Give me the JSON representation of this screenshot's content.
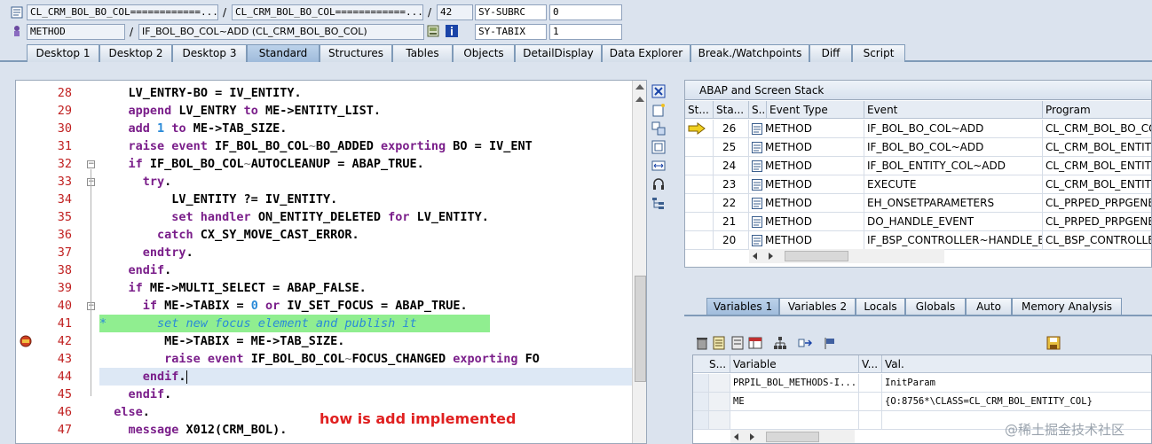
{
  "header": {
    "row1": {
      "f1": "CL_CRM_BOL_BO_COL============...",
      "sep1": "/",
      "f2": "CL_CRM_BOL_BO_COL============...",
      "sep2": "/",
      "f3": "42",
      "f4": "SY-SUBRC",
      "f5": "0"
    },
    "row2": {
      "f1": "METHOD",
      "sep1": "/",
      "f2": "IF_BOL_BO_COL~ADD (CL_CRM_BOL_BO_COL)",
      "f4": "SY-TABIX",
      "f5": "1"
    }
  },
  "tabs": [
    "Desktop 1",
    "Desktop 2",
    "Desktop 3",
    "Standard",
    "Structures",
    "Tables",
    "Objects",
    "DetailDisplay",
    "Data Explorer",
    "Break./Watchpoints",
    "Diff",
    "Script"
  ],
  "active_tab": "Standard",
  "editor": {
    "lines": [
      {
        "n": "28",
        "t": [
          [
            "    ",
            ""
          ],
          [
            "LV_ENTRY",
            ""
          ],
          [
            "-",
            ""
          ],
          [
            "BO = IV_ENTITY.",
            ""
          ]
        ]
      },
      {
        "n": "29",
        "t": [
          [
            "    ",
            ""
          ],
          [
            "append",
            "kw"
          ],
          [
            " LV_ENTRY ",
            ""
          ],
          [
            "to",
            "kw"
          ],
          [
            " ME->ENTITY_LIST.",
            ""
          ]
        ]
      },
      {
        "n": "30",
        "t": [
          [
            "    ",
            ""
          ],
          [
            "add",
            "kw"
          ],
          [
            " ",
            ""
          ],
          [
            "1",
            "num"
          ],
          [
            " ",
            ""
          ],
          [
            "to",
            "kw"
          ],
          [
            " ME->TAB_SIZE.",
            ""
          ]
        ]
      },
      {
        "n": "31",
        "t": [
          [
            "    ",
            ""
          ],
          [
            "raise event",
            "kw"
          ],
          [
            " IF_BOL_BO_COL",
            ""
          ],
          [
            "~",
            "opr"
          ],
          [
            "BO_ADDED ",
            ""
          ],
          [
            "exporting",
            "kw"
          ],
          [
            " BO = IV_ENT",
            ""
          ]
        ]
      },
      {
        "n": "32",
        "t": [
          [
            "    ",
            ""
          ],
          [
            "if",
            "kw"
          ],
          [
            " IF_BOL_BO_COL",
            ""
          ],
          [
            "~",
            "opr"
          ],
          [
            "AUTOCLEANUP = ABAP_TRUE.",
            ""
          ]
        ]
      },
      {
        "n": "33",
        "t": [
          [
            "      ",
            ""
          ],
          [
            "try",
            "kw"
          ],
          [
            ".",
            ""
          ]
        ]
      },
      {
        "n": "34",
        "t": [
          [
            "          LV_ENTITY ?= IV_ENTITY.",
            ""
          ]
        ]
      },
      {
        "n": "35",
        "t": [
          [
            "          ",
            ""
          ],
          [
            "set handler",
            "kw"
          ],
          [
            " ON_ENTITY_DELETED ",
            ""
          ],
          [
            "for",
            "kw"
          ],
          [
            " LV_ENTITY.",
            ""
          ]
        ]
      },
      {
        "n": "36",
        "t": [
          [
            "        ",
            ""
          ],
          [
            "catch",
            "kw"
          ],
          [
            " CX_SY_MOVE_CAST_ERROR.",
            ""
          ]
        ]
      },
      {
        "n": "37",
        "t": [
          [
            "      ",
            ""
          ],
          [
            "endtry",
            "kw"
          ],
          [
            ".",
            ""
          ]
        ]
      },
      {
        "n": "38",
        "t": [
          [
            "    ",
            ""
          ],
          [
            "endif",
            "kw"
          ],
          [
            ".",
            ""
          ]
        ]
      },
      {
        "n": "39",
        "t": [
          [
            "    ",
            ""
          ],
          [
            "if",
            "kw"
          ],
          [
            " ME->MULTI_SELECT = ABAP_FALSE.",
            ""
          ]
        ]
      },
      {
        "n": "40",
        "t": [
          [
            "      ",
            ""
          ],
          [
            "if",
            "kw"
          ],
          [
            " ME->TABIX = ",
            ""
          ],
          [
            "0",
            "num"
          ],
          [
            " ",
            ""
          ],
          [
            "or",
            "kw"
          ],
          [
            " IV_SET_FOCUS = ABAP_TRUE.",
            ""
          ]
        ]
      },
      {
        "n": "41",
        "t": [
          [
            "*       set new focus element and publish it",
            "cmt"
          ]
        ]
      },
      {
        "n": "42",
        "t": [
          [
            "         ME->TABIX = ME->TAB_SIZE.",
            ""
          ]
        ]
      },
      {
        "n": "43",
        "t": [
          [
            "         ",
            ""
          ],
          [
            "raise event",
            "kw"
          ],
          [
            " IF_BOL_BO_COL",
            ""
          ],
          [
            "~",
            "opr"
          ],
          [
            "FOCUS_CHANGED ",
            ""
          ],
          [
            "exporting",
            "kw"
          ],
          [
            " FO",
            ""
          ]
        ]
      },
      {
        "n": "44",
        "t": [
          [
            "      ",
            ""
          ],
          [
            "endif",
            "kw"
          ],
          [
            ".",
            ""
          ]
        ]
      },
      {
        "n": "45",
        "t": [
          [
            "    ",
            ""
          ],
          [
            "endif",
            "kw"
          ],
          [
            ".",
            ""
          ]
        ]
      },
      {
        "n": "46",
        "t": [
          [
            "  ",
            ""
          ],
          [
            "else",
            "kw"
          ],
          [
            ".",
            ""
          ]
        ]
      },
      {
        "n": "47",
        "t": [
          [
            "    ",
            ""
          ],
          [
            "message",
            "kw"
          ],
          [
            " X012(CRM_BOL).",
            ""
          ]
        ]
      }
    ]
  },
  "stack": {
    "title": "ABAP and Screen Stack",
    "columns": [
      "St...",
      "Sta...",
      "S...",
      "Event Type",
      "Event",
      "Program"
    ],
    "rows": [
      {
        "level": "26",
        "type": "METHOD",
        "event": "IF_BOL_BO_COL~ADD",
        "program": "CL_CRM_BOL_BO_COL",
        "current": true
      },
      {
        "level": "25",
        "type": "METHOD",
        "event": "IF_BOL_BO_COL~ADD",
        "program": "CL_CRM_BOL_ENTITY",
        "current": false
      },
      {
        "level": "24",
        "type": "METHOD",
        "event": "IF_BOL_ENTITY_COL~ADD",
        "program": "CL_CRM_BOL_ENTITY",
        "current": false
      },
      {
        "level": "23",
        "type": "METHOD",
        "event": "EXECUTE",
        "program": "CL_CRM_BOL_ENTITY",
        "current": false
      },
      {
        "level": "22",
        "type": "METHOD",
        "event": "EH_ONSETPARAMETERS",
        "program": "CL_PRPED_PRPGENER",
        "current": false
      },
      {
        "level": "21",
        "type": "METHOD",
        "event": "DO_HANDLE_EVENT",
        "program": "CL_PRPED_PRPGENER",
        "current": false
      },
      {
        "level": "20",
        "type": "METHOD",
        "event": "IF_BSP_CONTROLLER~HANDLE_E...",
        "program": "CL_BSP_CONTROLLER",
        "current": false
      }
    ]
  },
  "var_tabs": [
    "Variables 1",
    "Variables 2",
    "Locals",
    "Globals",
    "Auto",
    "Memory Analysis"
  ],
  "variables": {
    "columns": [
      "S...",
      "Variable",
      "V...",
      "Val."
    ],
    "rows": [
      {
        "name": "PRPIL_BOL_METHODS-I...",
        "value": "InitParam"
      },
      {
        "name": "ME",
        "value": "{O:8756*\\CLASS=CL_CRM_BOL_ENTITY_COL}"
      },
      {
        "name": "",
        "value": ""
      }
    ]
  },
  "annotation": "how is add implemented",
  "watermark": "@稀土掘金技术社区",
  "colors": {
    "keyword": "#7a1e8a",
    "number": "#2a8ad8",
    "comment_bg": "#90ee90",
    "line_number": "#c02020",
    "annotation": "#e02020"
  }
}
